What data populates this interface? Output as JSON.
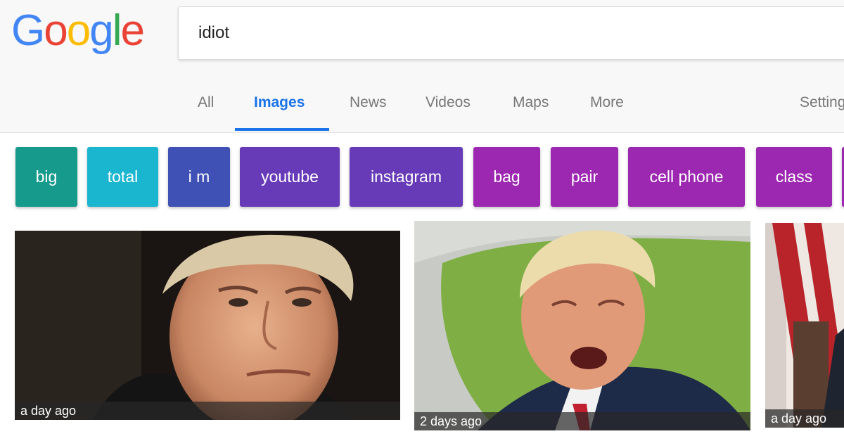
{
  "logo": {
    "letters": [
      "G",
      "o",
      "o",
      "g",
      "l",
      "e"
    ],
    "colors": [
      "#4285f4",
      "#ea4335",
      "#fbbc05",
      "#4285f4",
      "#34a853",
      "#ea4335"
    ]
  },
  "search": {
    "query": "idiot"
  },
  "tabs": [
    {
      "label": "All",
      "active": false
    },
    {
      "label": "Images",
      "active": true
    },
    {
      "label": "News",
      "active": false
    },
    {
      "label": "Videos",
      "active": false
    },
    {
      "label": "Maps",
      "active": false
    },
    {
      "label": "More",
      "active": false
    }
  ],
  "settings_label": "Settings",
  "chips": [
    {
      "label": "big",
      "color": "#169a8c"
    },
    {
      "label": "total",
      "color": "#1ab6cf"
    },
    {
      "label": "i m",
      "color": "#3f51b5"
    },
    {
      "label": "youtube",
      "color": "#673ab7"
    },
    {
      "label": "instagram",
      "color": "#673ab7"
    },
    {
      "label": "bag",
      "color": "#9c27b0"
    },
    {
      "label": "pair",
      "color": "#9c27b0"
    },
    {
      "label": "cell phone",
      "color": "#9c27b0"
    },
    {
      "label": "class",
      "color": "#9c27b0"
    }
  ],
  "results": [
    {
      "caption": "a day ago"
    },
    {
      "caption": "2 days ago"
    },
    {
      "caption": "a day ago"
    }
  ],
  "colors": {
    "accent": "#1a73e8"
  }
}
